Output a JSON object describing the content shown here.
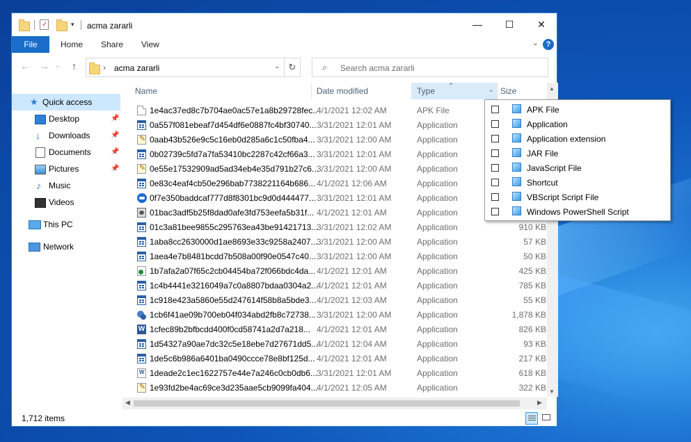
{
  "window": {
    "title": "acma zararli"
  },
  "ribbon": {
    "file": "File",
    "tabs": [
      "Home",
      "Share",
      "View"
    ]
  },
  "address": {
    "path": "acma zararli",
    "separator": "›",
    "search_placeholder": "Search acma zararli"
  },
  "nav": {
    "items": [
      {
        "label": "Quick access",
        "icon": "star-icon"
      },
      {
        "label": "Desktop",
        "icon": "desktop-icon"
      },
      {
        "label": "Downloads",
        "icon": "download-icon"
      },
      {
        "label": "Documents",
        "icon": "documents-icon"
      },
      {
        "label": "Pictures",
        "icon": "pictures-icon"
      },
      {
        "label": "Music",
        "icon": "music-icon"
      },
      {
        "label": "Videos",
        "icon": "videos-icon"
      },
      {
        "label": "This PC",
        "icon": "pc-icon"
      },
      {
        "label": "Network",
        "icon": "network-icon"
      }
    ]
  },
  "columns": {
    "name": "Name",
    "date": "Date modified",
    "type": "Type",
    "size": "Size"
  },
  "files": [
    {
      "name": "1e4ac37ed8c7b704ae0ac57e1a8b29728fec...",
      "date": "4/1/2021 12:02 AM",
      "type": "APK File",
      "size": "",
      "icon": "doc"
    },
    {
      "name": "0a557f081ebeaf7d454df6e0887fc4bf30740...",
      "date": "3/31/2021 12:01 AM",
      "type": "Application",
      "size": "",
      "icon": "app"
    },
    {
      "name": "0aab43b526e9c5c16eb0d285a6c1c50fba4...",
      "date": "3/31/2021 12:00 AM",
      "type": "Application",
      "size": "",
      "icon": "note"
    },
    {
      "name": "0b02739c5fd7a7fa53410bc2287c42cf66a3...",
      "date": "3/31/2021 12:01 AM",
      "type": "Application",
      "size": "",
      "icon": "app"
    },
    {
      "name": "0e55e17532909ad5ad34eb4e35d791b27c6...",
      "date": "3/31/2021 12:00 AM",
      "type": "Application",
      "size": "",
      "icon": "note"
    },
    {
      "name": "0e83c4eaf4cb50e296bab7738221164b686...",
      "date": "4/1/2021 12:06 AM",
      "type": "Application",
      "size": "",
      "icon": "app"
    },
    {
      "name": "0f7e350baddcaf777d8f8301bc9d0d444477...",
      "date": "3/31/2021 12:01 AM",
      "type": "Application",
      "size": "",
      "icon": "cloud"
    },
    {
      "name": "01bac3adf5b25f8dad0afe3fd753eefa5b31f...",
      "date": "4/1/2021 12:01 AM",
      "type": "Application",
      "size": "",
      "icon": "media"
    },
    {
      "name": "01c3a81bee9855c295763ea43be91421713...",
      "date": "3/31/2021 12:02 AM",
      "type": "Application",
      "size": "910 KB",
      "icon": "app"
    },
    {
      "name": "1aba8cc2630000d1ae8693e33c9258a2407...",
      "date": "3/31/2021 12:00 AM",
      "type": "Application",
      "size": "57 KB",
      "icon": "app"
    },
    {
      "name": "1aea4e7b8481bcdd7b508a00f90e0547c40...",
      "date": "3/31/2021 12:00 AM",
      "type": "Application",
      "size": "50 KB",
      "icon": "app"
    },
    {
      "name": "1b7afa2a07f65c2cb04454ba72f066bdc4da...",
      "date": "4/1/2021 12:01 AM",
      "type": "Application",
      "size": "425 KB",
      "icon": "xls"
    },
    {
      "name": "1c4b4441e3216049a7c0a8807bdaa0304a2...",
      "date": "4/1/2021 12:01 AM",
      "type": "Application",
      "size": "785 KB",
      "icon": "app"
    },
    {
      "name": "1c918e423a5860e55d247614f58b8a5bde3...",
      "date": "4/1/2021 12:03 AM",
      "type": "Application",
      "size": "55 KB",
      "icon": "app"
    },
    {
      "name": "1cb6f41ae09b700eb04f034abd2fb8c72738...",
      "date": "3/31/2021 12:00 AM",
      "type": "Application",
      "size": "1,878 KB",
      "icon": "gear"
    },
    {
      "name": "1cfec89b2bfbcdd400f0cd58741a2d7a218...",
      "date": "4/1/2021 12:01 AM",
      "type": "Application",
      "size": "826 KB",
      "icon": "word"
    },
    {
      "name": "1d54327a90ae7dc32c5e18ebe7d27671dd5...",
      "date": "4/1/2021 12:04 AM",
      "type": "Application",
      "size": "93 KB",
      "icon": "app"
    },
    {
      "name": "1de5c6b986a6401ba0490ccce78e8bf125d...",
      "date": "4/1/2021 12:01 AM",
      "type": "Application",
      "size": "217 KB",
      "icon": "app"
    },
    {
      "name": "1deade2c1ec1622757e44e7a246c0cb0db6...",
      "date": "3/31/2021 12:01 AM",
      "type": "Application",
      "size": "618 KB",
      "icon": "vbs"
    },
    {
      "name": "1e93fd2be4ac69ce3d235aae5cb9099fa404...",
      "date": "4/1/2021 12:05 AM",
      "type": "Application",
      "size": "322 KB",
      "icon": "note"
    }
  ],
  "type_filter": {
    "options": [
      {
        "label": "APK File",
        "checked": false
      },
      {
        "label": "Application",
        "checked": false
      },
      {
        "label": "Application extension",
        "checked": false
      },
      {
        "label": "JAR File",
        "checked": false
      },
      {
        "label": "JavaScript File",
        "checked": false
      },
      {
        "label": "Shortcut",
        "checked": false
      },
      {
        "label": "VBScript Script File",
        "checked": false
      },
      {
        "label": "Windows PowerShell Script",
        "checked": false
      }
    ]
  },
  "status": {
    "item_count": "1,712 items"
  },
  "colors": {
    "accent": "#1a6dc8",
    "selected": "#cce8ff",
    "type_header": "#d9ebf9"
  }
}
